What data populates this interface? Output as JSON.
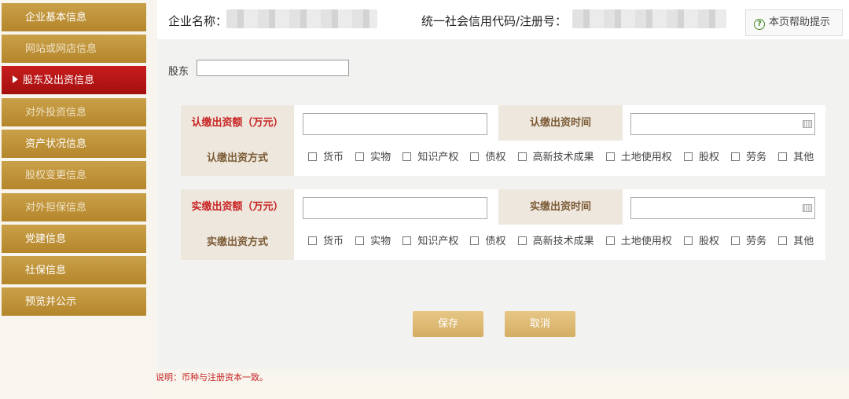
{
  "sidebar": {
    "items": [
      {
        "label": "企业基本信息"
      },
      {
        "label": "网站或网店信息"
      },
      {
        "label": "股东及出资信息"
      },
      {
        "label": "对外投资信息"
      },
      {
        "label": "资产状况信息"
      },
      {
        "label": "股权变更信息"
      },
      {
        "label": "对外担保信息"
      },
      {
        "label": "党建信息"
      },
      {
        "label": "社保信息"
      },
      {
        "label": "预览并公示"
      }
    ],
    "active_index": 2
  },
  "header": {
    "company_label": "企业名称：",
    "code_label": "统一社会信用代码/注册号：",
    "help_label": "本页帮助提示",
    "help_icon": "question-circle-icon"
  },
  "shareholder": {
    "label": "股东",
    "value": ""
  },
  "subscribed": {
    "amount_label": "认缴出资额（万元）",
    "time_label": "认缴出资时间",
    "method_label": "认缴出资方式",
    "amount_value": "",
    "time_value": "",
    "methods": [
      "货币",
      "实物",
      "知识产权",
      "债权",
      "高新技术成果",
      "土地使用权",
      "股权",
      "劳务",
      "其他"
    ]
  },
  "paid": {
    "amount_label": "实缴出资额（万元）",
    "time_label": "实缴出资时间",
    "method_label": "实缴出资方式",
    "amount_value": "",
    "time_value": "",
    "methods": [
      "货币",
      "实物",
      "知识产权",
      "债权",
      "高新技术成果",
      "土地使用权",
      "股权",
      "劳务",
      "其他"
    ]
  },
  "buttons": {
    "save": "保存",
    "cancel": "取消"
  },
  "note": "说明：币种与注册资本一致。",
  "colors": {
    "nav_gold": "#c19438",
    "nav_active": "#b81616",
    "head_cell": "#eee7dd",
    "button_gold": "#ddb874",
    "note_red": "#c82323"
  }
}
